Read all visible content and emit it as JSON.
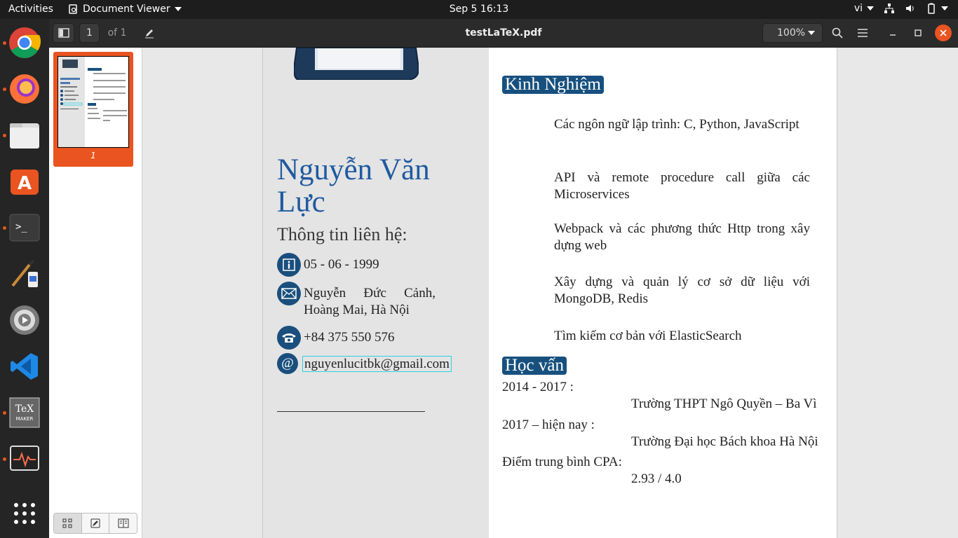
{
  "topbar": {
    "activities": "Activities",
    "app_name": "Document Viewer",
    "clock": "Sep 5  16:13",
    "input_lang": "vi"
  },
  "dock": {
    "items": [
      "chrome-icon",
      "firefox-icon",
      "files-icon",
      "software-icon",
      "terminal-icon",
      "paint-icon",
      "settings-icon",
      "vscode-icon",
      "texmaker-icon",
      "system-monitor-icon",
      "apps-grid-icon"
    ]
  },
  "header": {
    "page_number": "1",
    "page_of": "of 1",
    "title": "testLaTeX.pdf",
    "zoom": "100%"
  },
  "sidebar": {
    "thumbnail_label": "1"
  },
  "document": {
    "name": "Nguyễn Văn Lực",
    "contact_title": "Thông tin liên hệ:",
    "contacts": {
      "birthday": "05 - 06 - 1999",
      "address": "Nguyễn Đức Cảnh, Hoàng Mai, Hà Nội",
      "phone": "+84 375 550 576",
      "email": "nguyenlucitbk@gmail.com"
    },
    "at_symbol": "@",
    "experience_title": "Kinh Nghiệm",
    "experience": [
      "Các ngôn ngữ lập trình: C, Python, JavaScript",
      "API và remote procedure call giữa các Microservices",
      "Webpack và các phương thức Http trong xây dựng web",
      "Xây dựng và quản lý cơ sở dữ liệu với MongoDB, Redis",
      "Tìm kiếm cơ bản với ElasticSearch"
    ],
    "education_title": "Học vấn",
    "education": [
      {
        "period": "2014 - 2017 :",
        "school": "Trường THPT Ngô Quyền – Ba Vì"
      },
      {
        "period": "2017 – hiện nay :",
        "school": "Trường Đại học Bách khoa Hà Nội"
      }
    ],
    "gpa_label": "Điểm trung bình CPA:",
    "gpa_value": "2.93 / 4.0"
  },
  "colors": {
    "accent": "#e95420",
    "section_bg": "#17507e",
    "name_color": "#1f5aa0"
  }
}
